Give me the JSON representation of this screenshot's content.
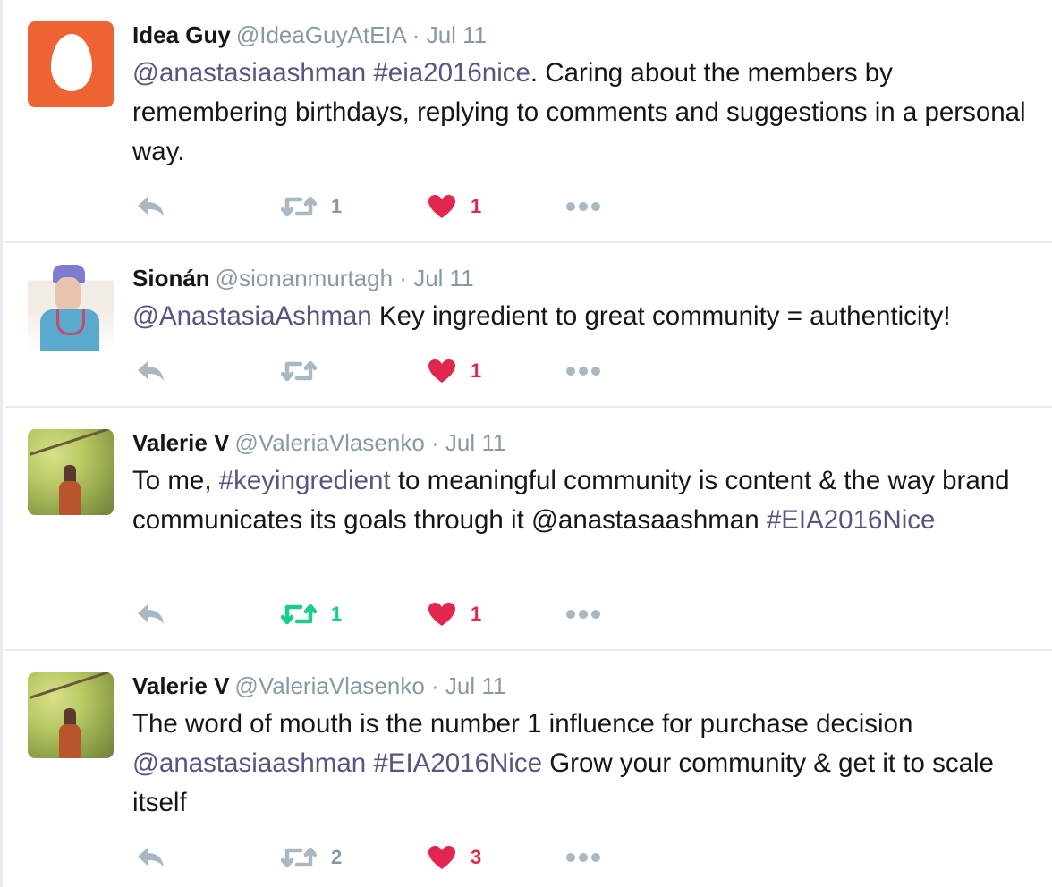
{
  "colors": {
    "link": "#5b5481",
    "muted": "#8899a6",
    "like": "#e2264d",
    "retweet_active": "#19cf86",
    "egg_avatar": "#ee6333"
  },
  "icons": {
    "reply": "reply-icon",
    "retweet": "retweet-icon",
    "like": "heart-icon",
    "more": "more-dots-icon"
  },
  "tweets": [
    {
      "name": "Idea Guy",
      "handle": "@IdeaGuyAtEIA",
      "sep": "·",
      "date": "Jul 11",
      "text_parts": [
        {
          "text": "@anastasiaashman",
          "link": true
        },
        {
          "text": " ",
          "link": false
        },
        {
          "text": "#eia2016nice",
          "link": true
        },
        {
          "text": ". Caring about the members by remembering birthdays, replying to comments and suggestions in a personal way.",
          "link": false
        }
      ],
      "retweets": "1",
      "retweeted": false,
      "likes": "1"
    },
    {
      "name": "Sionán",
      "handle": "@sionanmurtagh",
      "sep": "·",
      "date": "Jul 11",
      "text_parts": [
        {
          "text": "@AnastasiaAshman",
          "link": true
        },
        {
          "text": " Key ingredient to great community = authenticity!",
          "link": false
        }
      ],
      "retweets": "",
      "retweeted": false,
      "likes": "1"
    },
    {
      "name": "Valerie V",
      "handle": "@ValeriaVlasenko",
      "sep": "·",
      "date": "Jul 11",
      "text_parts": [
        {
          "text": "To me, ",
          "link": false
        },
        {
          "text": "#keyingredient",
          "link": true
        },
        {
          "text": " to meaningful community is content & the way brand communicates its goals through it @anastasaashman ",
          "link": false
        },
        {
          "text": "#EIA2016Nice",
          "link": true
        }
      ],
      "retweets": "1",
      "retweeted": true,
      "likes": "1"
    },
    {
      "name": "Valerie V",
      "handle": "@ValeriaVlasenko",
      "sep": "·",
      "date": "Jul 11",
      "text_parts": [
        {
          "text": "The word of mouth is the number 1 influence for purchase decision ",
          "link": false
        },
        {
          "text": "@anastasiaashman",
          "link": true
        },
        {
          "text": " ",
          "link": false
        },
        {
          "text": "#EIA2016Nice",
          "link": true
        },
        {
          "text": " Grow your community & get it to scale itself",
          "link": false
        }
      ],
      "retweets": "2",
      "retweeted": false,
      "likes": "3"
    }
  ]
}
